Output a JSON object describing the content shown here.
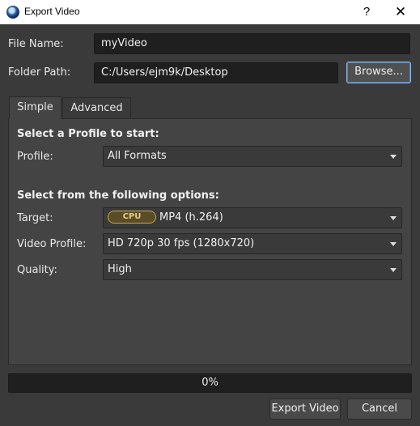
{
  "window": {
    "title": "Export Video",
    "help_glyph": "?",
    "close_glyph": "✕"
  },
  "file_name": {
    "label": "File Name:",
    "value": "myVideo"
  },
  "folder_path": {
    "label": "Folder Path:",
    "value": "C:/Users/ejm9k/Desktop",
    "browse_label": "Browse..."
  },
  "tabs": [
    {
      "label": "Simple",
      "active": true
    },
    {
      "label": "Advanced",
      "active": false
    }
  ],
  "simple": {
    "profile_heading": "Select a Profile to start:",
    "profile": {
      "label": "Profile:",
      "value": "All Formats"
    },
    "options_heading": "Select from the following options:",
    "target": {
      "label": "Target:",
      "badge": "CPU",
      "value": "MP4 (h.264)"
    },
    "video_profile": {
      "label": "Video Profile:",
      "value": "HD 720p 30 fps (1280x720)"
    },
    "quality": {
      "label": "Quality:",
      "value": "High"
    }
  },
  "progress": {
    "value": 0,
    "text": "0%"
  },
  "buttons": {
    "export_label": "Export Video",
    "cancel_label": "Cancel"
  },
  "colors": {
    "background": "#3a3a3a",
    "panel": "#444444",
    "field": "#1f1f1f",
    "badge_border": "#c9a64a",
    "focus_border": "#8fb8e0"
  },
  "icons": {
    "app": "openshot-app-icon",
    "help": "help-icon",
    "close": "close-icon",
    "dropdown": "chevron-down-icon"
  }
}
